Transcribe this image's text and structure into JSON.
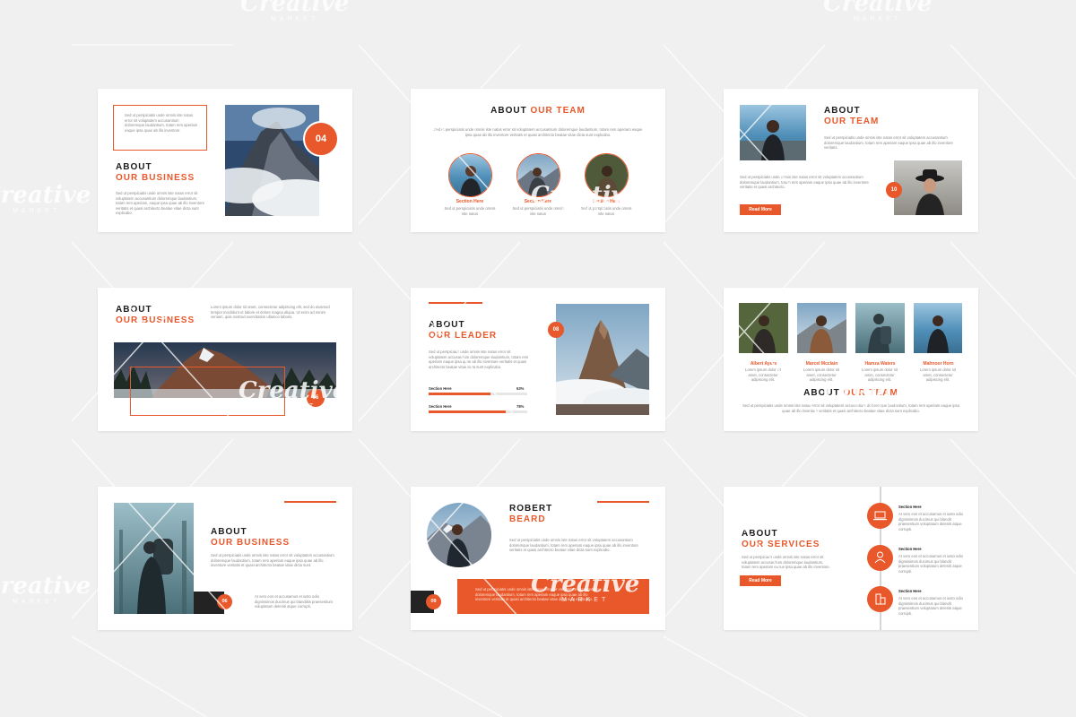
{
  "accent_color": "#e8582a",
  "watermark": {
    "brand": "Creative",
    "sub": "MARKET"
  },
  "slide1": {
    "heading_1": "ABOUT",
    "heading_2": "OUR BUSINESS",
    "number": "04",
    "text_box": "Sed ut perspiciatis unde omnis iste natus error sit voluptatem accusantium doloremque laudantium, totam rem aperiam eaque ipsa quae ab illo inventore",
    "paragraph": "Sed ut perspiciatis unde omnis iste natus error sit voluptatem accusantium doloremque laudantium, totam rem aperiam, eaque ipsa quae ab illo inventore veritatis et quasi architecto beatae vitae dicta sunt explicabo."
  },
  "slide2": {
    "heading_1": "ABOUT",
    "heading_2": "OUR TEAM",
    "paragraph": "Sed ut perspiciatis unde omnis iste natus error sit voluptatem accusantium doloremque laudantium, totam rem aperiam eaque ipsa quae ab illo inventore veritatis et quasi architecto beatae vitae dicta sunt explicabo.",
    "members": [
      {
        "label": "Section Here",
        "text": "Sed ut perspiciatis unde omnis iste natus"
      },
      {
        "label": "Section Here",
        "text": "Sed ut perspiciatis unde omnis iste natus"
      },
      {
        "label": "Section Here",
        "text": "Sed ut perspiciatis unde omnis iste natus"
      }
    ]
  },
  "slide3": {
    "heading_1": "ABOUT",
    "heading_2": "OUR TEAM",
    "number": "10",
    "button": "Read More",
    "paragraph_1": "Sed ut perspiciatis unde omnis iste natus error sit voluptatem accusantium doloremque laudantium, totam rem aperiam eaque ipsa quae ab illo inventore veritatis.",
    "paragraph_2": "Sed ut perspiciatis unde omnis iste natus error sit voluptatem accusantium doloremque laudantium, totam rem aperiam eaque ipsa quae ab illo inventore veritatis et quasi architecto."
  },
  "slide4": {
    "heading_1": "ABOUT",
    "heading_2": "OUR BUSINESS",
    "number": "05",
    "paragraph": "Lorem ipsum dolor sit amet, consectetur adipiscing elit, sed do eiusmod tempor incididunt ut labore et dolore magna aliqua. Ut enim ad minim veniam, quis nostrud exercitation ullamco laboris."
  },
  "slide5": {
    "heading_1": "ABOUT",
    "heading_2": "OUR LEADER",
    "number": "08",
    "paragraph": "Sed ut perspiciatis unde omnis iste natus error sit voluptatem accusantium doloremque laudantium, totam rem aperiam eaque ipsa quae ab illo inventore veritatis et quasi architecto beatae vitae dicta sunt explicabo.",
    "bars": [
      {
        "label": "Section Here",
        "value": "63%",
        "fill": 0.63
      },
      {
        "label": "Section Here",
        "value": "78%",
        "fill": 0.78
      }
    ]
  },
  "slide6": {
    "heading_1": "ABOUT",
    "heading_2": "OUR TEAM",
    "paragraph": "Sed ut perspiciatis unde omnis iste natus error sit voluptatem accusantium doloremque laudantium, totam rem aperiam eaque ipsa quae ab illo inventore veritatis et quasi architecto beatae vitae dicta sunt explicabo.",
    "members": [
      {
        "name": "Albert Ayers",
        "text": "Lorem ipsum dolor sit amet, consectetur adipiscing elit."
      },
      {
        "name": "Marcel Mcclain",
        "text": "Lorem ipsum dolor sit amet, consectetur adipiscing elit."
      },
      {
        "name": "Hamza Waters",
        "text": "Lorem ipsum dolor sit amet, consectetur adipiscing elit."
      },
      {
        "name": "Mahnoor Horn",
        "text": "Lorem ipsum dolor sit amet, consectetur adipiscing elit."
      }
    ]
  },
  "slide7": {
    "heading_1": "ABOUT",
    "heading_2": "OUR BUSINESS",
    "number": "06",
    "paragraph_1": "Sed ut perspiciatis unde omnis iste natus error sit voluptatem accusantium doloremque laudantium, totam rem aperiam eaque ipsa quae ab illo inventore veritatis et quasi architecto beatae vitae dicta sunt.",
    "paragraph_2": "At vero eos et accusamus et iusto odio dignissimos ducimus qui blanditiis praesentium voluptatum deleniti atque corrupti."
  },
  "slide8": {
    "heading_1": "ROBERT",
    "heading_2": "BEARD",
    "number": "09",
    "paragraph": "Sed ut perspiciatis unde omnis iste natus error sit voluptatem accusantium doloremque laudantium, totam rem aperiam eaque ipsa quae ab illo inventore veritatis et quasi architecto beatae vitae dicta sunt explicabo.",
    "box_text": "Sed ut perspiciatis unde omnis iste natus error sit voluptatem accusantium doloremque laudantium, totam rem aperiam eaque ipsa quae ab illo inventore veritatis et quasi architecto beatae vitae dicta sunt explicabo."
  },
  "slide9": {
    "heading_1": "ABOUT",
    "heading_2": "OUR SERVICES",
    "button": "Read More",
    "paragraph": "Sed ut perspiciatis unde omnis iste natus error sit voluptatem accusantium doloremque laudantium, totam rem aperiam eaque ipsa quae ab illo inventore.",
    "items": [
      {
        "label": "Section Here",
        "text": "At vero eos et accusamus et iusto odio dignissimos ducimus qui blandit praesentium voluptatum deleniti atque corrupti."
      },
      {
        "label": "Section Here",
        "text": "At vero eos et accusamus et iusto odio dignissimos ducimus qui blandit praesentium voluptatum deleniti atque corrupti."
      },
      {
        "label": "Section Here",
        "text": "At vero eos et accusamus et iusto odio dignissimos ducimus qui blandit praesentium voluptatum deleniti atque corrupti."
      }
    ]
  }
}
